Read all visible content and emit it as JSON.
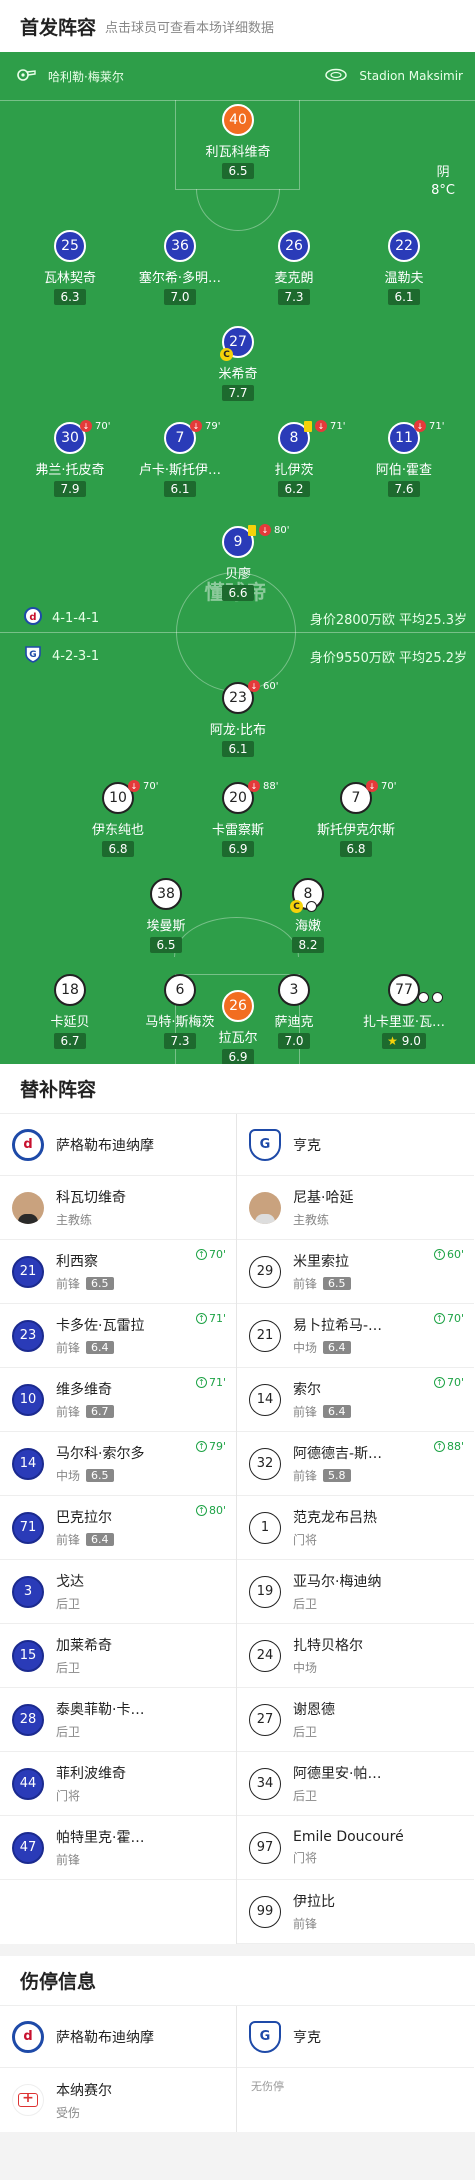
{
  "header": {
    "title": "首发阵容",
    "subtitle": "点击球员可查看本场详细数据"
  },
  "venue": {
    "referee": "哈利勒·梅莱尔",
    "stadium": "Stadion Maksimir"
  },
  "weather": {
    "condition": "阴",
    "temperature": "8°C"
  },
  "watermark": "懂球帝",
  "home_form": {
    "formation": "4-1-4-1",
    "value": "身价2800万欧 平均25.3岁"
  },
  "away_form": {
    "formation": "4-2-3-1",
    "value": "身价9550万欧 平均25.2岁"
  },
  "home_players": [
    {
      "num": "40",
      "name": "利瓦科维奇",
      "rating": "6.5",
      "gk": true
    },
    {
      "num": "25",
      "name": "瓦林契奇",
      "rating": "6.3"
    },
    {
      "num": "36",
      "name": "塞尔希·多明…",
      "rating": "7.0"
    },
    {
      "num": "26",
      "name": "麦克朗",
      "rating": "7.3"
    },
    {
      "num": "22",
      "name": "温勒夫",
      "rating": "6.1"
    },
    {
      "num": "27",
      "name": "米希奇",
      "rating": "7.7"
    },
    {
      "num": "30",
      "name": "弗兰·托皮奇",
      "rating": "7.9",
      "badge": "70'"
    },
    {
      "num": "7",
      "name": "卢卡·斯托伊…",
      "rating": "6.1",
      "badge": "79'"
    },
    {
      "num": "8",
      "name": "扎伊茨",
      "rating": "6.2",
      "badge": "71'"
    },
    {
      "num": "11",
      "name": "阿伯·霍查",
      "rating": "7.6",
      "badge": "71'"
    },
    {
      "num": "9",
      "name": "贝廖",
      "rating": "6.6",
      "badge": "80'"
    }
  ],
  "away_players": [
    {
      "num": "23",
      "name": "阿龙·比布",
      "rating": "6.1",
      "badge": "60'"
    },
    {
      "num": "10",
      "name": "伊东纯也",
      "rating": "6.8",
      "badge": "70'"
    },
    {
      "num": "20",
      "name": "卡雷察斯",
      "rating": "6.9",
      "badge": "88'"
    },
    {
      "num": "7",
      "name": "斯托伊克尔斯",
      "rating": "6.8",
      "badge": "70'"
    },
    {
      "num": "38",
      "name": "埃曼斯",
      "rating": "6.5"
    },
    {
      "num": "8",
      "name": "海嫩",
      "rating": "8.2"
    },
    {
      "num": "18",
      "name": "卡延贝",
      "rating": "6.7"
    },
    {
      "num": "6",
      "name": "马特·斯梅茨",
      "rating": "7.3"
    },
    {
      "num": "3",
      "name": "萨迪克",
      "rating": "7.0"
    },
    {
      "num": "77",
      "name": "扎卡里亚·瓦…",
      "rating": "9.0"
    },
    {
      "num": "26",
      "name": "拉瓦尔",
      "rating": "6.9",
      "gk": true
    }
  ],
  "subs_section": {
    "title": "替补阵容"
  },
  "home_team": {
    "name": "萨格勒布迪纳摩",
    "logo": "d"
  },
  "away_team": {
    "name": "亨克",
    "logo": "G"
  },
  "home_coach": {
    "name": "科瓦切维奇",
    "role": "主教练"
  },
  "away_coach": {
    "name": "尼基·哈延",
    "role": "主教练"
  },
  "home_subs": [
    {
      "num": "21",
      "name": "利西察",
      "pos": "前锋",
      "rating": "6.5",
      "time": "70'"
    },
    {
      "num": "23",
      "name": "卡多佐·瓦雷拉",
      "pos": "前锋",
      "rating": "6.4",
      "time": "71'"
    },
    {
      "num": "10",
      "name": "维多维奇",
      "pos": "前锋",
      "rating": "6.7",
      "time": "71'"
    },
    {
      "num": "14",
      "name": "马尔科·索尔多",
      "pos": "中场",
      "rating": "6.5",
      "time": "79'"
    },
    {
      "num": "71",
      "name": "巴克拉尔",
      "pos": "前锋",
      "rating": "6.4",
      "time": "80'"
    },
    {
      "num": "3",
      "name": "戈达",
      "pos": "后卫"
    },
    {
      "num": "15",
      "name": "加莱希奇",
      "pos": "后卫"
    },
    {
      "num": "28",
      "name": "泰奥菲勒·卡…",
      "pos": "后卫"
    },
    {
      "num": "44",
      "name": "菲利波维奇",
      "pos": "门将"
    },
    {
      "num": "47",
      "name": "帕特里克·霍…",
      "pos": "前锋"
    }
  ],
  "away_subs": [
    {
      "num": "29",
      "name": "米里索拉",
      "pos": "前锋",
      "rating": "6.5",
      "time": "60'"
    },
    {
      "num": "21",
      "name": "易卜拉希马-…",
      "pos": "中场",
      "rating": "6.4",
      "time": "70'"
    },
    {
      "num": "14",
      "name": "索尔",
      "pos": "前锋",
      "rating": "6.4",
      "time": "70'"
    },
    {
      "num": "32",
      "name": "阿德德吉-斯…",
      "pos": "前锋",
      "rating": "5.8",
      "time": "88'"
    },
    {
      "num": "1",
      "name": "范克龙布吕热",
      "pos": "门将"
    },
    {
      "num": "19",
      "name": "亚马尔·梅迪纳",
      "pos": "后卫"
    },
    {
      "num": "24",
      "name": "扎特贝格尔",
      "pos": "中场"
    },
    {
      "num": "27",
      "name": "谢恩德",
      "pos": "后卫"
    },
    {
      "num": "34",
      "name": "阿德里安·帕…",
      "pos": "后卫"
    },
    {
      "num": "97",
      "name": "Emile Doucouré",
      "pos": "门将"
    },
    {
      "num": "99",
      "name": "伊拉比",
      "pos": "前锋"
    }
  ],
  "injury_section": {
    "title": "伤停信息"
  },
  "home_injury": {
    "name": "本纳赛尔",
    "status": "受伤"
  },
  "away_injury": {
    "text": "无伤停"
  }
}
